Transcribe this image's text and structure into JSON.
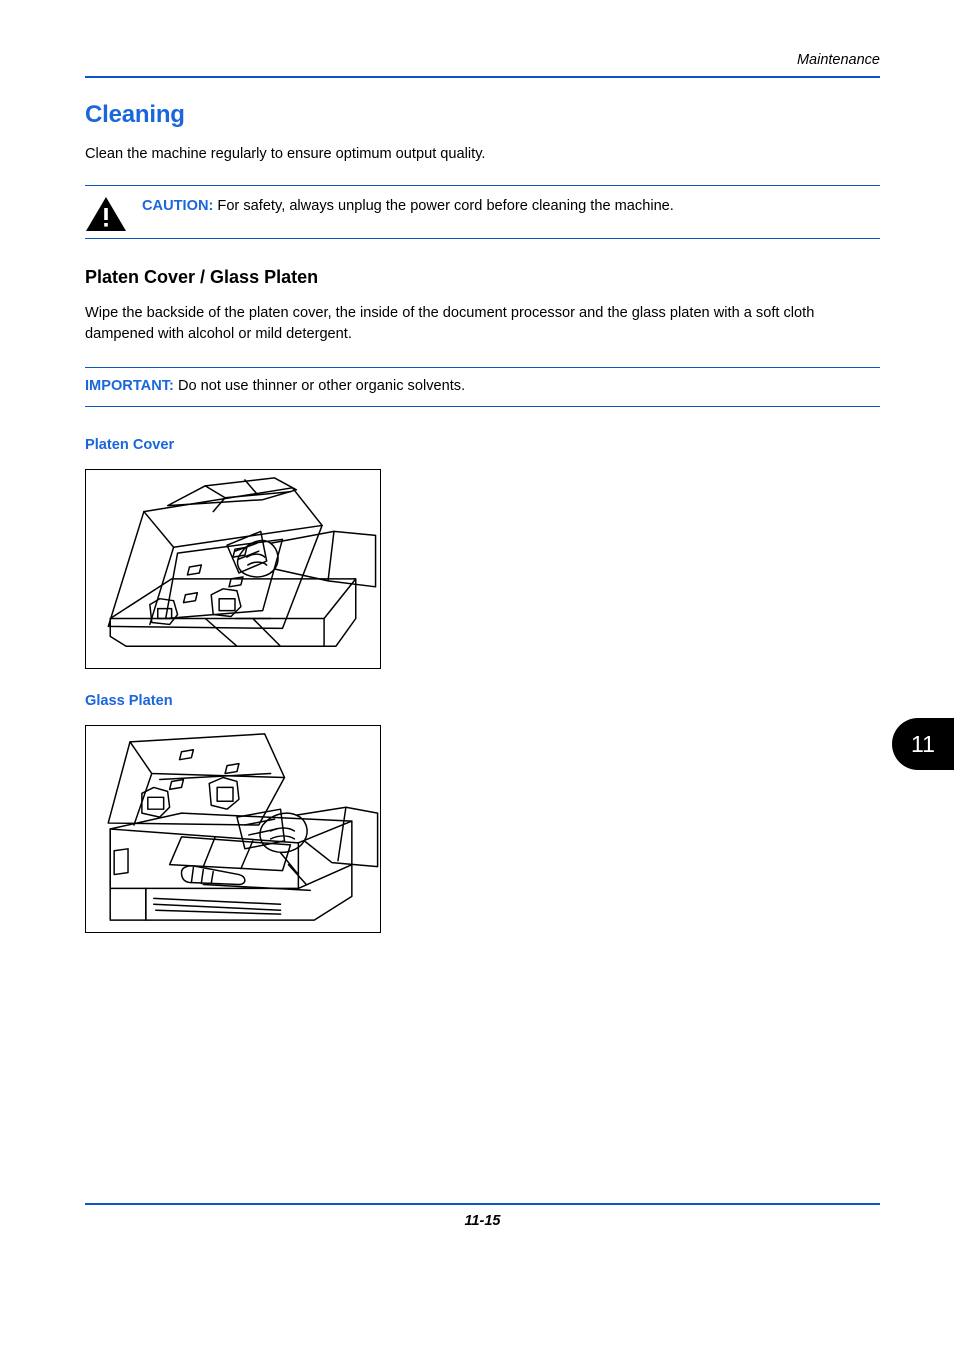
{
  "header": {
    "running_head": "Maintenance",
    "rule_color": "#0b55c4"
  },
  "colors": {
    "heading_blue": "#1a66dc",
    "rule_blue": "#0b55c4",
    "text_black": "#000000",
    "page_background": "#ffffff",
    "tab_background": "#000000",
    "tab_text": "#ffffff"
  },
  "main": {
    "section_title": "Cleaning",
    "intro_paragraph": "Clean the machine regularly to ensure optimum output quality.",
    "caution": {
      "icon": "warning-triangle-icon",
      "label": "CAUTION:",
      "text": "For safety, always unplug the power cord before cleaning the machine."
    },
    "subsection_title": "Platen Cover / Glass Platen",
    "subsection_paragraph": "Wipe the backside of the platen cover, the inside of the document processor and the glass platen with a soft cloth dampened with alcohol or mild detergent.",
    "important": {
      "label": "IMPORTANT:",
      "text": "Do not use thinner or other organic solvents."
    },
    "figures": [
      {
        "heading": "Platen Cover",
        "caption": "",
        "alt": "Line drawing of a hand wiping the backside of the raised platen cover of the multifunction printer"
      },
      {
        "heading": "Glass Platen",
        "caption": "",
        "alt": "Line drawing of a hand wiping the glass platen of the multifunction printer with the cover raised"
      }
    ]
  },
  "chapter_tab": {
    "number": "11"
  },
  "footer": {
    "page_number": "11-15"
  }
}
